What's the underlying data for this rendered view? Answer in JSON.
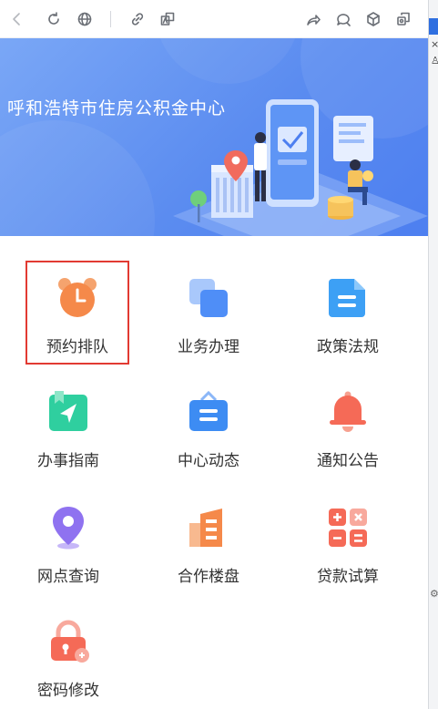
{
  "toolbar": {
    "icons": [
      "back-icon",
      "refresh-icon",
      "globe-icon",
      "link-icon",
      "translate-icon",
      "share-icon",
      "chat-icon",
      "cube-icon",
      "export-icon"
    ]
  },
  "banner": {
    "title": "呼和浩特市住房公积金中心"
  },
  "services": [
    {
      "label": "预约排队",
      "icon": "alarm-clock-icon",
      "color": "#f5894a",
      "highlighted": true
    },
    {
      "label": "业务办理",
      "icon": "stacked-squares-icon",
      "color": "#4f8ef7"
    },
    {
      "label": "政策法规",
      "icon": "document-icon",
      "color": "#3da0f5"
    },
    {
      "label": "办事指南",
      "icon": "navigation-book-icon",
      "color": "#2fcf9f"
    },
    {
      "label": "中心动态",
      "icon": "news-board-icon",
      "color": "#3d8cf3"
    },
    {
      "label": "通知公告",
      "icon": "bell-icon",
      "color": "#f56a57"
    },
    {
      "label": "网点查询",
      "icon": "location-pin-icon",
      "color": "#8f72f0"
    },
    {
      "label": "合作楼盘",
      "icon": "building-icon",
      "color": "#f5894a"
    },
    {
      "label": "贷款试算",
      "icon": "calculator-icon",
      "color": "#f56a57"
    },
    {
      "label": "密码修改",
      "icon": "padlock-icon",
      "color": "#f56a57"
    }
  ]
}
